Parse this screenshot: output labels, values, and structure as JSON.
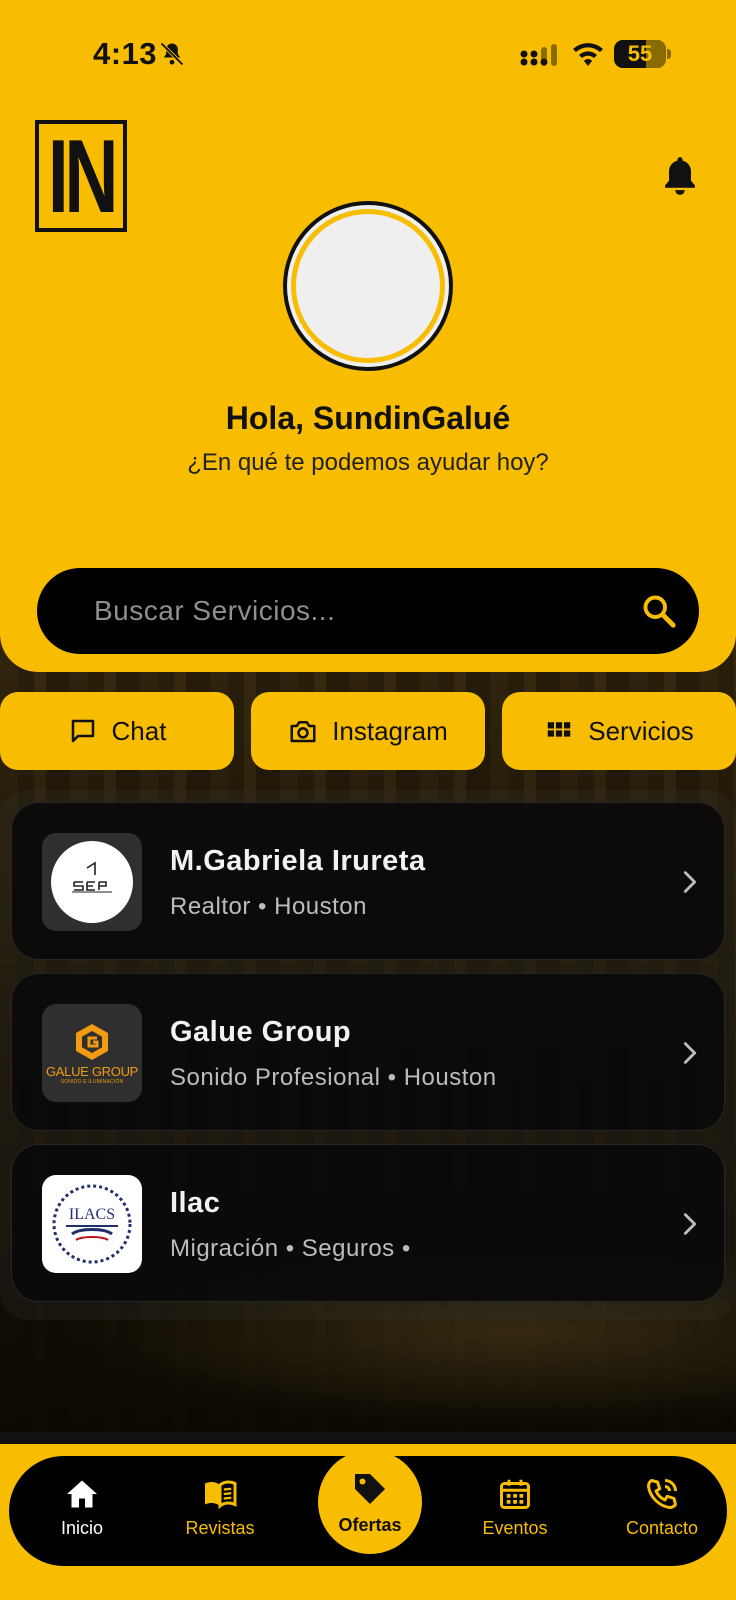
{
  "colors": {
    "accent": "#f8bd00",
    "dark": "#000000",
    "card": "#0a0a0a"
  },
  "status": {
    "time": "4:13",
    "battery": "55"
  },
  "brand": {
    "logo_text": "IN"
  },
  "profile": {
    "greeting": "Hola, SundinGalué",
    "subtitle": "¿En qué te podemos ayudar hoy?"
  },
  "search": {
    "placeholder": "Buscar Servicios..."
  },
  "actions": [
    {
      "label": "Chat",
      "icon": "chat-bubble-icon"
    },
    {
      "label": "Instagram",
      "icon": "camera-icon"
    },
    {
      "label": "Servicios",
      "icon": "grid-icon"
    }
  ],
  "listings": [
    {
      "name": "M.Gabriela Irureta",
      "meta": "Realtor • Houston",
      "logo": "step-logo"
    },
    {
      "name": "Galue Group",
      "meta": "Sonido Profesional • Houston",
      "logo": "galue-group-logo",
      "logo_text": "GALUE GROUP",
      "logo_subtext": "SONIDO E ILUMINACIÓN"
    },
    {
      "name": "Ilac",
      "meta": "Migración • Seguros •",
      "logo": "ilacs-logo",
      "logo_text": "ILACS"
    }
  ],
  "nav": [
    {
      "label": "Inicio",
      "icon": "home-icon",
      "active": true
    },
    {
      "label": "Revistas",
      "icon": "book-icon"
    },
    {
      "label": "Ofertas",
      "icon": "tag-icon"
    },
    {
      "label": "Eventos",
      "icon": "calendar-icon"
    },
    {
      "label": "Contacto",
      "icon": "phone-icon"
    }
  ]
}
